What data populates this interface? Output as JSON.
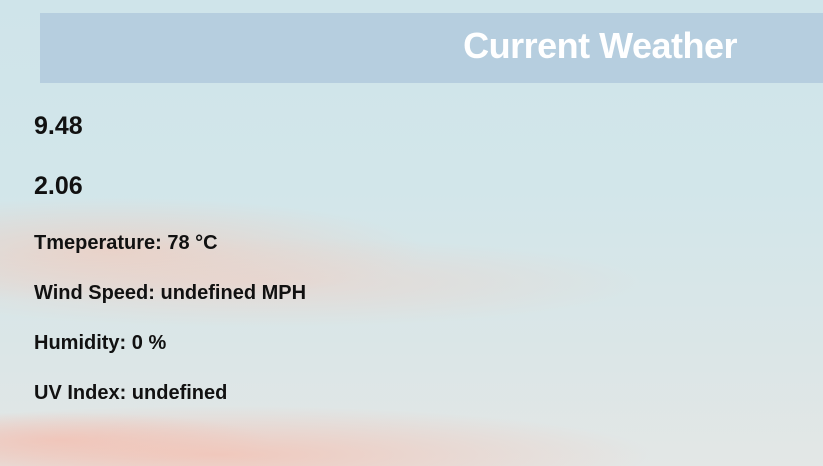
{
  "header": {
    "title": "Current Weather"
  },
  "values": {
    "first": "9.48",
    "second": "2.06"
  },
  "details": {
    "temperature": "Tmeperature: 78 °C",
    "wind_speed": "Wind Speed: undefined MPH",
    "humidity": "Humidity: 0 %",
    "uv_index": "UV Index: undefined"
  },
  "colors": {
    "header_bg": "#b6cedf",
    "header_text": "#ffffff",
    "body_text": "#111111"
  }
}
